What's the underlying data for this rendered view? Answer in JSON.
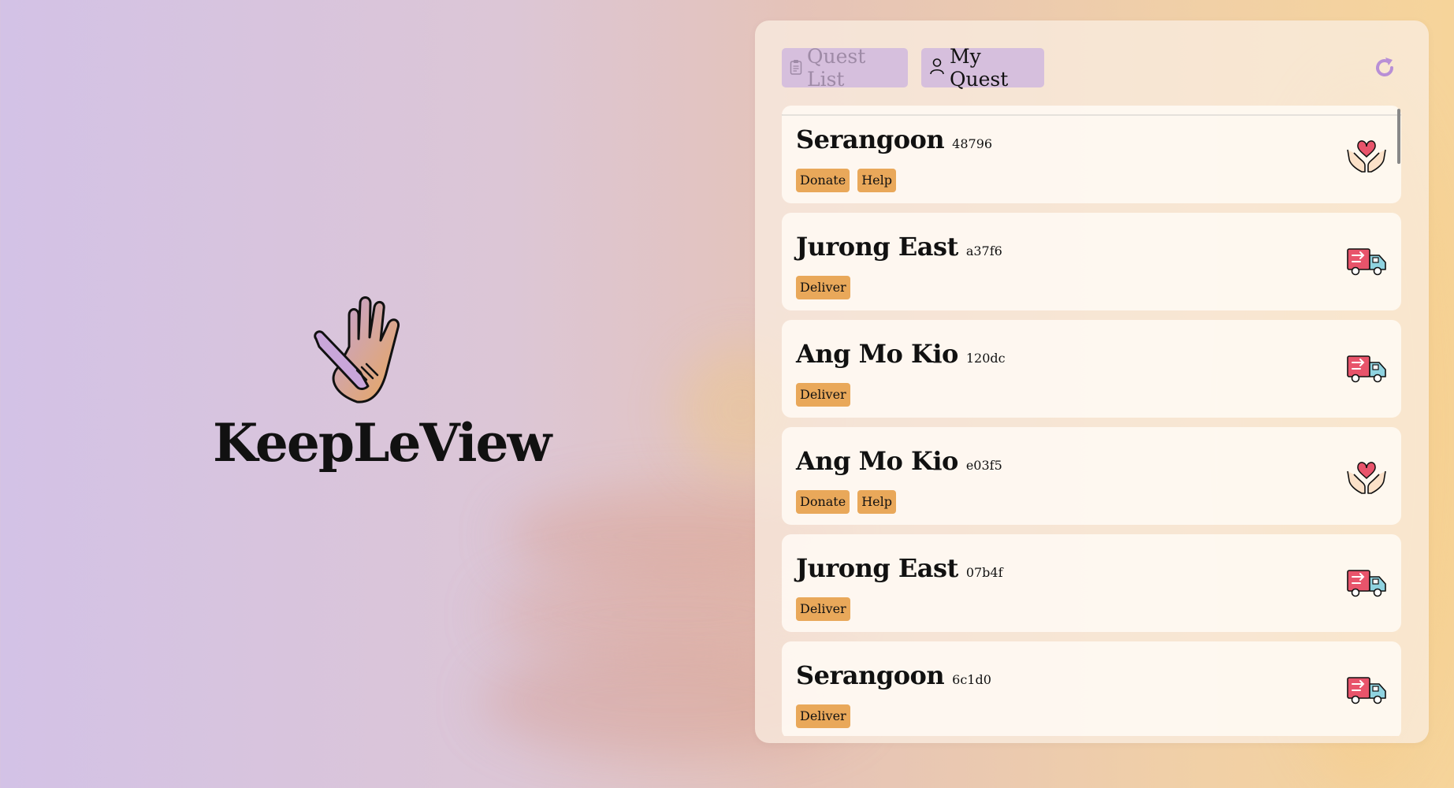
{
  "brand": {
    "name": "KeepLeView"
  },
  "tabs": [
    {
      "label": "Quest List",
      "icon": "clipboard-icon"
    },
    {
      "label": "My Quest",
      "icon": "user-icon"
    }
  ],
  "refresh_icon": "refresh-icon",
  "colors": {
    "accent": "#d6bfdd",
    "tag": "#e9a85a",
    "heart": "#e8546b",
    "truck": "#e8546b"
  },
  "quests": [
    {
      "location": "Serangoon",
      "code": "48796",
      "tags": [
        "Donate",
        "Help"
      ],
      "icon": "donate-hands-icon"
    },
    {
      "location": "Jurong East",
      "code": "a37f6",
      "tags": [
        "Deliver"
      ],
      "icon": "delivery-truck-icon"
    },
    {
      "location": "Ang Mo Kio",
      "code": "120dc",
      "tags": [
        "Deliver"
      ],
      "icon": "delivery-truck-icon"
    },
    {
      "location": "Ang Mo Kio",
      "code": "e03f5",
      "tags": [
        "Donate",
        "Help"
      ],
      "icon": "donate-hands-icon"
    },
    {
      "location": "Jurong East",
      "code": "07b4f",
      "tags": [
        "Deliver"
      ],
      "icon": "delivery-truck-icon"
    },
    {
      "location": "Serangoon",
      "code": "6c1d0",
      "tags": [
        "Deliver"
      ],
      "icon": "delivery-truck-icon"
    }
  ]
}
